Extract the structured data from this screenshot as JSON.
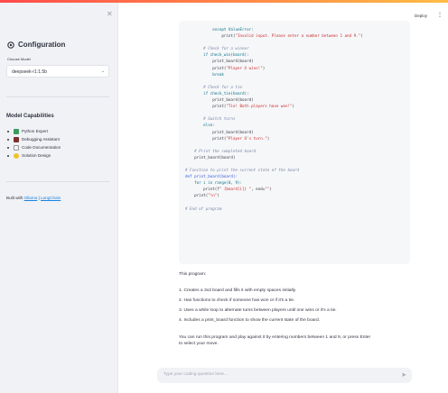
{
  "header": {
    "deploy_label": "Deploy",
    "menu_icon": "kebab-menu-icon"
  },
  "sidebar": {
    "collapse_icon": "close-icon",
    "config_title": "Configuration",
    "config_icon": "gear-icon",
    "model_label": "Choose Model",
    "model_value": "deepseek-r1:1.5b",
    "capabilities_title": "Model Capabilities",
    "capabilities": [
      {
        "icon": "snake-icon",
        "label": "Python Expert"
      },
      {
        "icon": "bug-icon",
        "label": "Debugging Assistant"
      },
      {
        "icon": "memo-icon",
        "label": "Code Documentation"
      },
      {
        "icon": "lightbulb-icon",
        "label": "Solution Design"
      }
    ],
    "built_prefix": "Built with ",
    "built_link1": "Ollama",
    "built_sep": " | ",
    "built_link2": "LangChain"
  },
  "code": {
    "lines": [
      "            except ValueError:",
      "                print(\"Invalid input. Please enter a number between 1 and 9.\")",
      "",
      "        # Check for a winner",
      "        if check_win(board):",
      "            print_board(board)",
      "            print(\"Player X wins!\")",
      "            break",
      "",
      "        # Check for a tie",
      "        if check_tie(board):",
      "            print_board(board)",
      "            print(\"Tie! Both players have won!\")",
      "",
      "        # Switch turns",
      "        else:",
      "            print_board(board)",
      "            print(\"Player O's turn.\")",
      "",
      "    # Print the completed board",
      "    print_board(board)",
      "",
      "# Function to print the current state of the board",
      "def print_board(board):",
      "    for i in range(0, 9):",
      "        print(f\" {board[i]} \", end=\"\")",
      "    print(\"\\n\")",
      "",
      "# End of program"
    ]
  },
  "answer": {
    "intro": "This program:",
    "items": [
      "1.   Creates a 3x3 board and fills it with empty spaces initially.",
      "2.   Has functions to check if someone has won or if it's a tie.",
      "3.   Uses a while loop to alternate turns between players until one wins or it's a tie.",
      "4.   Includes a print_board function to show the current state of the board."
    ],
    "outro_line1": "You can run this program and play against it by entering numbers between 1 and 9, or press Enter",
    "outro_line2": "to select your move."
  },
  "chat": {
    "placeholder": "Type your coding question here...",
    "send_icon": "send-icon"
  }
}
